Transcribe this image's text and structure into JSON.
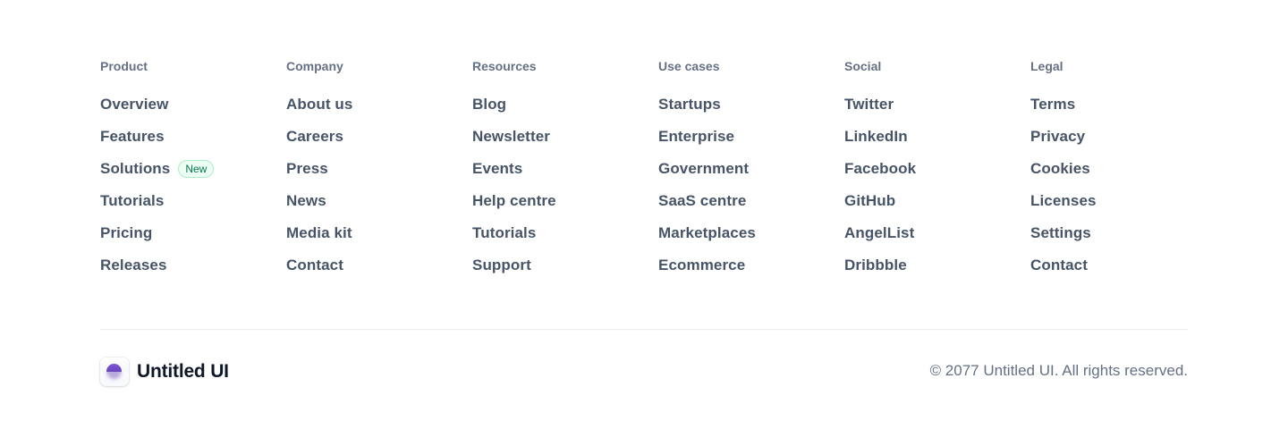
{
  "columns": [
    {
      "heading": "Product",
      "links": [
        "Overview",
        "Features",
        "Solutions",
        "Tutorials",
        "Pricing",
        "Releases"
      ],
      "badge": {
        "index": 2,
        "label": "New"
      }
    },
    {
      "heading": "Company",
      "links": [
        "About us",
        "Careers",
        "Press",
        "News",
        "Media kit",
        "Contact"
      ]
    },
    {
      "heading": "Resources",
      "links": [
        "Blog",
        "Newsletter",
        "Events",
        "Help centre",
        "Tutorials",
        "Support"
      ]
    },
    {
      "heading": "Use cases",
      "links": [
        "Startups",
        "Enterprise",
        "Government",
        "SaaS centre",
        "Marketplaces",
        "Ecommerce"
      ]
    },
    {
      "heading": "Social",
      "links": [
        "Twitter",
        "LinkedIn",
        "Facebook",
        "GitHub",
        "AngelList",
        "Dribbble"
      ]
    },
    {
      "heading": "Legal",
      "links": [
        "Terms",
        "Privacy",
        "Cookies",
        "Licenses",
        "Settings",
        "Contact"
      ]
    }
  ],
  "brand": {
    "name": "Untitled UI",
    "logo_icon": "untitled-ui-logo-icon"
  },
  "copyright": "© 2077 Untitled UI. All rights reserved.",
  "colors": {
    "heading": "#667085",
    "link": "#475467",
    "badge_text": "#067647",
    "badge_bg": "#ecfdf3",
    "badge_border": "#abefc6",
    "brand_text": "#101828",
    "logo_accent": "#7f56d9",
    "divider": "#eaecf0"
  }
}
